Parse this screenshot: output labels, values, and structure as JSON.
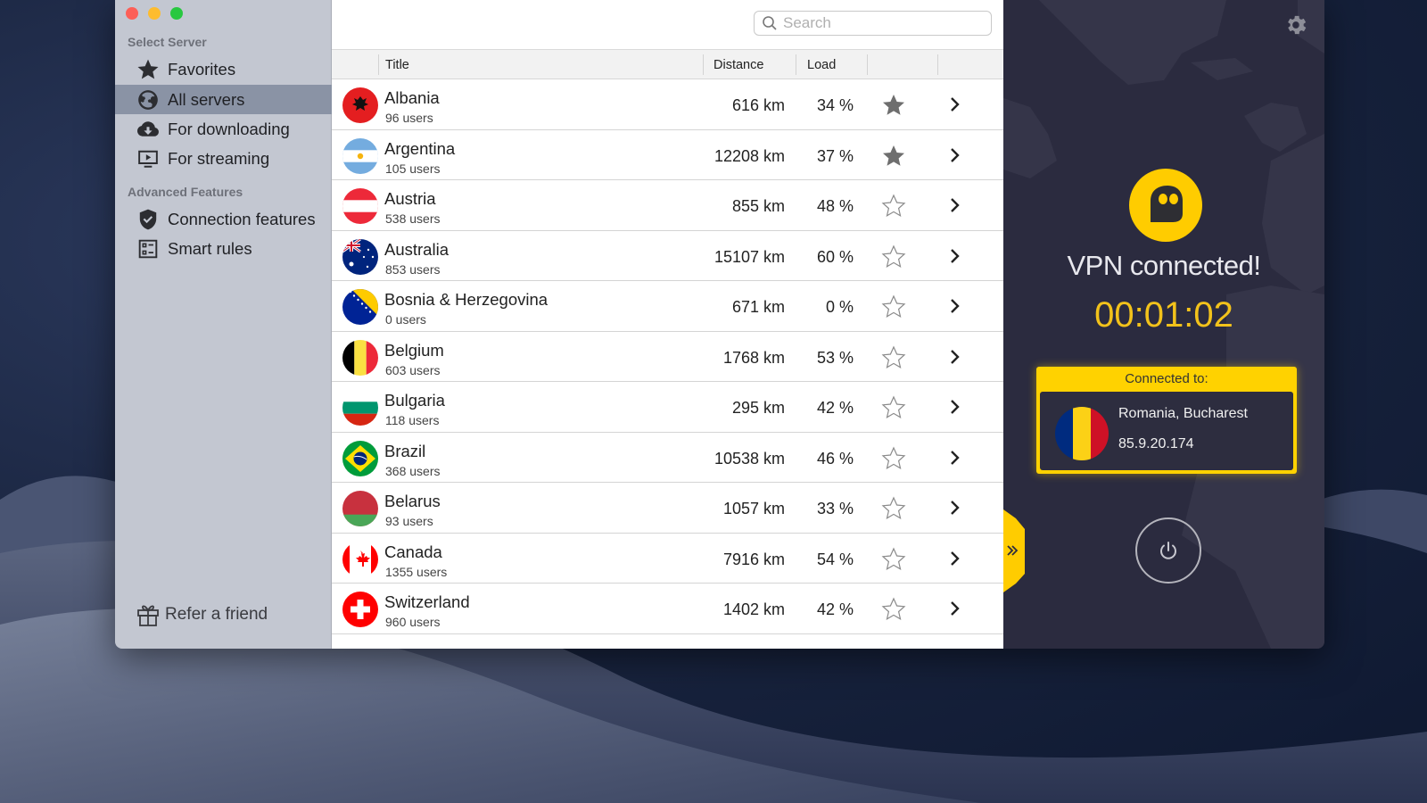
{
  "window": {
    "controls": [
      "close",
      "minimize",
      "maximize"
    ]
  },
  "sidebar": {
    "sections": [
      {
        "title": "Select Server",
        "items": [
          {
            "label": "Favorites",
            "icon": "star-icon",
            "active": false
          },
          {
            "label": "All servers",
            "icon": "globe-icon",
            "active": true
          },
          {
            "label": "For downloading",
            "icon": "cloud-download-icon",
            "active": false
          },
          {
            "label": "For streaming",
            "icon": "tv-play-icon",
            "active": false
          }
        ]
      },
      {
        "title": "Advanced Features",
        "items": [
          {
            "label": "Connection features",
            "icon": "shield-check-icon",
            "active": false
          },
          {
            "label": "Smart rules",
            "icon": "rules-list-icon",
            "active": false
          }
        ]
      }
    ],
    "refer": {
      "label": "Refer a friend",
      "icon": "gift-icon"
    }
  },
  "list": {
    "search": {
      "placeholder": "Search",
      "value": ""
    },
    "columns": {
      "title": "Title",
      "distance": "Distance",
      "load": "Load"
    },
    "rows": [
      {
        "country": "Albania",
        "users": "96 users",
        "distance": "616 km",
        "load": "34 %",
        "favorite": true,
        "flag": "albania"
      },
      {
        "country": "Argentina",
        "users": "105 users",
        "distance": "12208 km",
        "load": "37 %",
        "favorite": true,
        "flag": "argentina"
      },
      {
        "country": "Austria",
        "users": "538 users",
        "distance": "855 km",
        "load": "48 %",
        "favorite": false,
        "flag": "austria"
      },
      {
        "country": "Australia",
        "users": "853 users",
        "distance": "15107 km",
        "load": "60 %",
        "favorite": false,
        "flag": "australia"
      },
      {
        "country": "Bosnia & Herzegovina",
        "users": "0 users",
        "distance": "671 km",
        "load": "0 %",
        "favorite": false,
        "flag": "bosnia"
      },
      {
        "country": "Belgium",
        "users": "603 users",
        "distance": "1768 km",
        "load": "53 %",
        "favorite": false,
        "flag": "belgium"
      },
      {
        "country": "Bulgaria",
        "users": "118 users",
        "distance": "295 km",
        "load": "42 %",
        "favorite": false,
        "flag": "bulgaria"
      },
      {
        "country": "Brazil",
        "users": "368 users",
        "distance": "10538 km",
        "load": "46 %",
        "favorite": false,
        "flag": "brazil"
      },
      {
        "country": "Belarus",
        "users": "93 users",
        "distance": "1057 km",
        "load": "33 %",
        "favorite": false,
        "flag": "belarus"
      },
      {
        "country": "Canada",
        "users": "1355 users",
        "distance": "7916 km",
        "load": "54 %",
        "favorite": false,
        "flag": "canada"
      },
      {
        "country": "Switzerland",
        "users": "960 users",
        "distance": "1402 km",
        "load": "42 %",
        "favorite": false,
        "flag": "switzerland"
      }
    ]
  },
  "vpn": {
    "status": "VPN connected!",
    "timer": "00:01:02",
    "connected_label": "Connected to:",
    "location": "Romania, Bucharest",
    "ip": "85.9.20.174",
    "accent": "#ffcc00",
    "timer_color": "#f2c21b"
  }
}
